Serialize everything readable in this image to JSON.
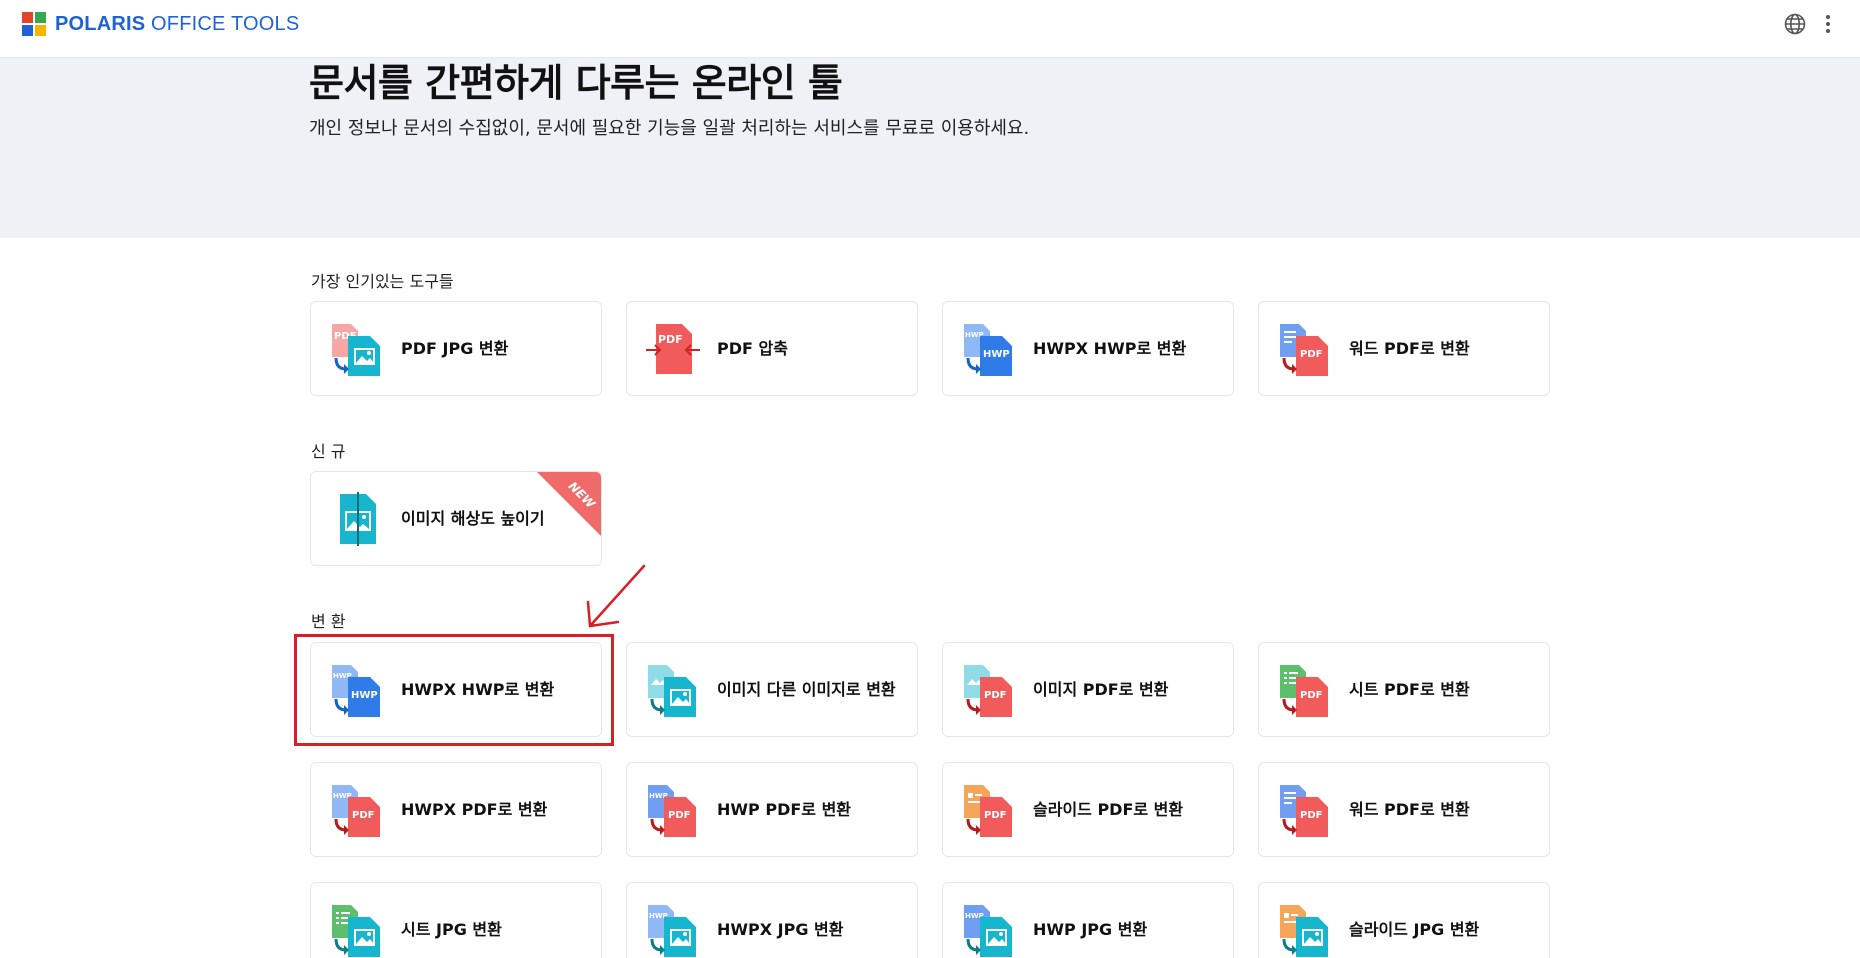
{
  "header": {
    "logo_bold": "POLARIS",
    "logo_rest": " OFFICE TOOLS",
    "logo_colors": [
      "#e8412c",
      "#35a852",
      "#1e63d6",
      "#f7b500"
    ]
  },
  "hero": {
    "title": "문서를 간편하게 다루는 온라인 툴",
    "subtitle": "개인 정보나 문서의 수집없이, 문서에 필요한 기능을 일괄 처리하는 서비스를 무료로 이용하세요."
  },
  "sections": {
    "popular": {
      "title": "가장 인기있는 도구들",
      "items": [
        {
          "label": "PDF JPG 변환",
          "icon": "pdf-to-jpg-icon"
        },
        {
          "label": "PDF 압축",
          "icon": "pdf-compress-icon"
        },
        {
          "label": "HWPX HWP로 변환",
          "icon": "hwpx-to-hwp-icon"
        },
        {
          "label": "워드 PDF로 변환",
          "icon": "word-to-pdf-icon"
        }
      ]
    },
    "new": {
      "title": "신 규",
      "badge": "NEW",
      "items": [
        {
          "label": "이미지 해상도 높이기",
          "icon": "image-upscale-icon"
        }
      ]
    },
    "convert": {
      "title": "변 환",
      "items": [
        {
          "label": "HWPX HWP로 변환",
          "icon": "hwpx-to-hwp-icon"
        },
        {
          "label": "이미지 다른 이미지로 변환",
          "icon": "image-to-image-icon"
        },
        {
          "label": "이미지 PDF로 변환",
          "icon": "image-to-pdf-icon"
        },
        {
          "label": "시트 PDF로 변환",
          "icon": "sheet-to-pdf-icon"
        },
        {
          "label": "HWPX PDF로 변환",
          "icon": "hwpx-to-pdf-icon"
        },
        {
          "label": "HWP PDF로 변환",
          "icon": "hwp-to-pdf-icon"
        },
        {
          "label": "슬라이드 PDF로 변환",
          "icon": "slide-to-pdf-icon"
        },
        {
          "label": "워드 PDF로 변환",
          "icon": "word-to-pdf-icon"
        },
        {
          "label": "시트 JPG 변환",
          "icon": "sheet-to-jpg-icon"
        },
        {
          "label": "HWPX JPG 변환",
          "icon": "hwpx-to-jpg-icon"
        },
        {
          "label": "HWP JPG 변환",
          "icon": "hwp-to-jpg-icon"
        },
        {
          "label": "슬라이드 JPG 변환",
          "icon": "slide-to-jpg-icon"
        }
      ]
    }
  },
  "icon_tags": {
    "pdf": "PDF",
    "hwp": "HWP",
    "hwp_small": "HWP"
  },
  "colors": {
    "pdf_red": "#f25b5b",
    "hwp_blue": "#2f7be8",
    "jpg_teal": "#16b6cf",
    "sheet_green": "#5cbf6b",
    "slide_orange": "#f5a55a",
    "word_blue": "#6f9ef2",
    "highlight_red": "#d61f26"
  }
}
